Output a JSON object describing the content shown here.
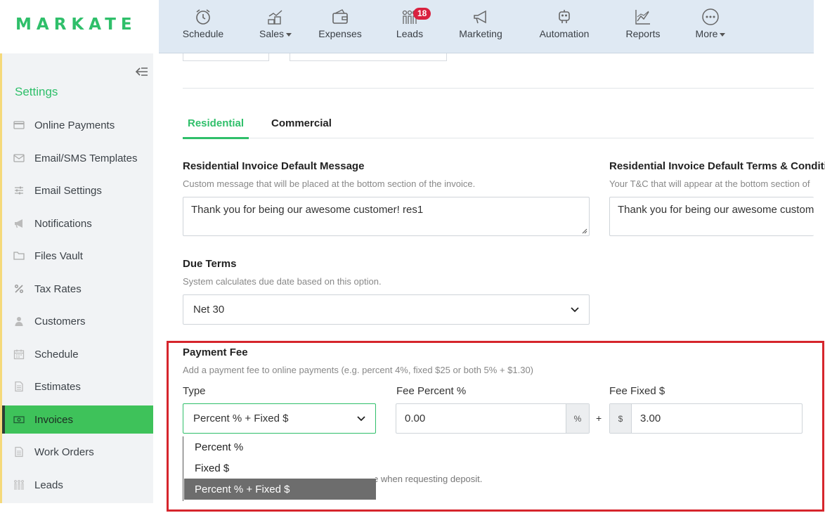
{
  "brand": {
    "logo": "MARKATE",
    "accent": "#2fbf6a",
    "active_bg": "#3ec25a",
    "highlight": "#d6252c"
  },
  "topnav": {
    "items": [
      {
        "label": "Schedule",
        "icon": "alarm-clock-icon",
        "dropdown": false
      },
      {
        "label": "Sales",
        "icon": "coins-chart-icon",
        "dropdown": true
      },
      {
        "label": "Expenses",
        "icon": "wallet-icon",
        "dropdown": false
      },
      {
        "label": "Leads",
        "icon": "people-icon",
        "dropdown": false,
        "badge": "18"
      },
      {
        "label": "Marketing",
        "icon": "megaphone-icon",
        "dropdown": false
      },
      {
        "label": "Automation",
        "icon": "robot-icon",
        "dropdown": false
      },
      {
        "label": "Reports",
        "icon": "line-chart-icon",
        "dropdown": false
      },
      {
        "label": "More",
        "icon": "more-dots-icon",
        "dropdown": true
      }
    ]
  },
  "sidebar": {
    "title": "Settings",
    "items": [
      {
        "label": "Online Payments",
        "icon": "credit-card-icon",
        "active": false
      },
      {
        "label": "Email/SMS Templates",
        "icon": "envelope-icon",
        "active": false
      },
      {
        "label": "Email Settings",
        "icon": "sliders-icon",
        "active": false
      },
      {
        "label": "Notifications",
        "icon": "megaphone-icon",
        "active": false
      },
      {
        "label": "Files Vault",
        "icon": "folder-icon",
        "active": false
      },
      {
        "label": "Tax Rates",
        "icon": "percent-icon",
        "active": false
      },
      {
        "label": "Customers",
        "icon": "user-icon",
        "active": false
      },
      {
        "label": "Schedule",
        "icon": "calendar-icon",
        "active": false
      },
      {
        "label": "Estimates",
        "icon": "document-icon",
        "active": false
      },
      {
        "label": "Invoices",
        "icon": "money-icon",
        "active": true
      },
      {
        "label": "Work Orders",
        "icon": "document-icon",
        "active": false
      },
      {
        "label": "Leads",
        "icon": "people-icon",
        "active": false
      }
    ]
  },
  "main": {
    "tabs": [
      {
        "label": "Residential",
        "active": true
      },
      {
        "label": "Commercial",
        "active": false
      }
    ],
    "default_message": {
      "label": "Residential Invoice Default Message",
      "help": "Custom message that will be placed at the bottom section of the invoice.",
      "value": "Thank you for being our awesome customer! res1"
    },
    "default_terms": {
      "label": "Residential Invoice Default Terms & Conditi",
      "help": "Your T&C that will appear at the bottom section of",
      "value": "Thank you for being our awesome custom"
    },
    "due_terms": {
      "label": "Due Terms",
      "help": "System calculates due date based on this option.",
      "value": "Net 30"
    },
    "payment_fee": {
      "label": "Payment Fee",
      "help": "Add a payment fee to online payments (e.g. percent 4%, fixed $25 or both 5% + $1.30)",
      "type_label": "Type",
      "type_value": "Percent % + Fixed $",
      "type_options": [
        "Percent %",
        "Fixed $",
        "Percent % + Fixed $"
      ],
      "percent_label": "Fee Percent %",
      "percent_value": "0.00",
      "percent_addon": "%",
      "plus": "+",
      "fixed_label": "Fee Fixed $",
      "fixed_addon": "$",
      "fixed_value": "3.00",
      "deposit_note_fragment": "e when requesting deposit."
    }
  }
}
